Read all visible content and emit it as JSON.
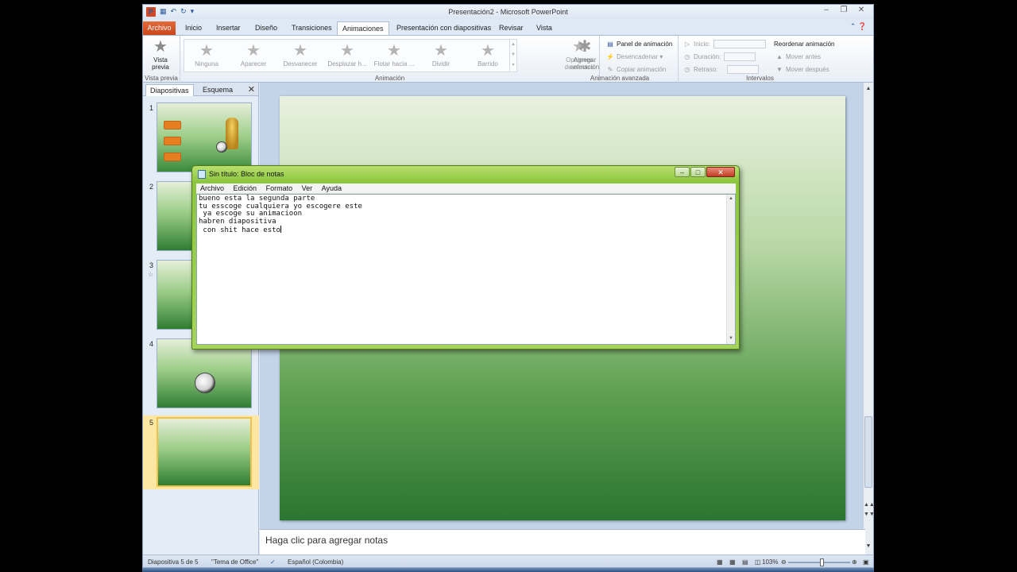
{
  "window": {
    "title": "Presentación2 - Microsoft PowerPoint",
    "app_icon": "P"
  },
  "tabs": [
    {
      "label": "Archivo"
    },
    {
      "label": "Inicio"
    },
    {
      "label": "Insertar"
    },
    {
      "label": "Diseño"
    },
    {
      "label": "Transiciones"
    },
    {
      "label": "Animaciones"
    },
    {
      "label": "Presentación con diapositivas"
    },
    {
      "label": "Revisar"
    },
    {
      "label": "Vista"
    }
  ],
  "ribbon": {
    "preview": {
      "label1": "Vista",
      "label2": "previa",
      "group": "Vista previa"
    },
    "animations": [
      {
        "label": "Ninguna"
      },
      {
        "label": "Aparecer"
      },
      {
        "label": "Desvanecer"
      },
      {
        "label": "Desplazar h..."
      },
      {
        "label": "Flotar hacia ..."
      },
      {
        "label": "Dividir"
      },
      {
        "label": "Barrido"
      }
    ],
    "effect_options": {
      "label1": "Opciones",
      "label2": "de efectos"
    },
    "animation_group": "Animación",
    "add_animation": {
      "label1": "Agregar",
      "label2": "animación"
    },
    "advanced": {
      "panel": "Panel de animación",
      "trigger": "Desencadenar",
      "copy": "Copiar animación",
      "group": "Animación avanzada"
    },
    "timing": {
      "start": "Inicio:",
      "duration": "Duración:",
      "delay": "Retraso:",
      "reorder": "Reordenar animación",
      "move_earlier": "Mover antes",
      "move_later": "Mover después",
      "group": "Intervalos"
    }
  },
  "leftpane": {
    "tab_slides": "Diapositivas",
    "tab_outline": "Esquema",
    "slides": [
      {
        "num": "1"
      },
      {
        "num": "2"
      },
      {
        "num": "3"
      },
      {
        "num": "4"
      },
      {
        "num": "5"
      }
    ]
  },
  "notes_placeholder": "Haga clic para agregar notas",
  "status": {
    "slide": "Diapositiva 5 de 5",
    "theme": "\"Tema de Office\"",
    "language": "Español (Colombia)",
    "zoom": "103%"
  },
  "notepad": {
    "title": "Sin título: Bloc de notas",
    "menu": [
      "Archivo",
      "Edición",
      "Formato",
      "Ver",
      "Ayuda"
    ],
    "lines": [
      "bueno esta la segunda parte",
      "tu esscoge cualquiera yo escogere este",
      " ya escoge su animacioon",
      "habren diapositiva",
      " con shit hace esto"
    ]
  },
  "colors": {
    "file_tab": "#c9461c",
    "slide_green_dark": "#2a7530",
    "notepad_frame": "#8cc63f",
    "selected_thumb": "#fde7a3"
  }
}
